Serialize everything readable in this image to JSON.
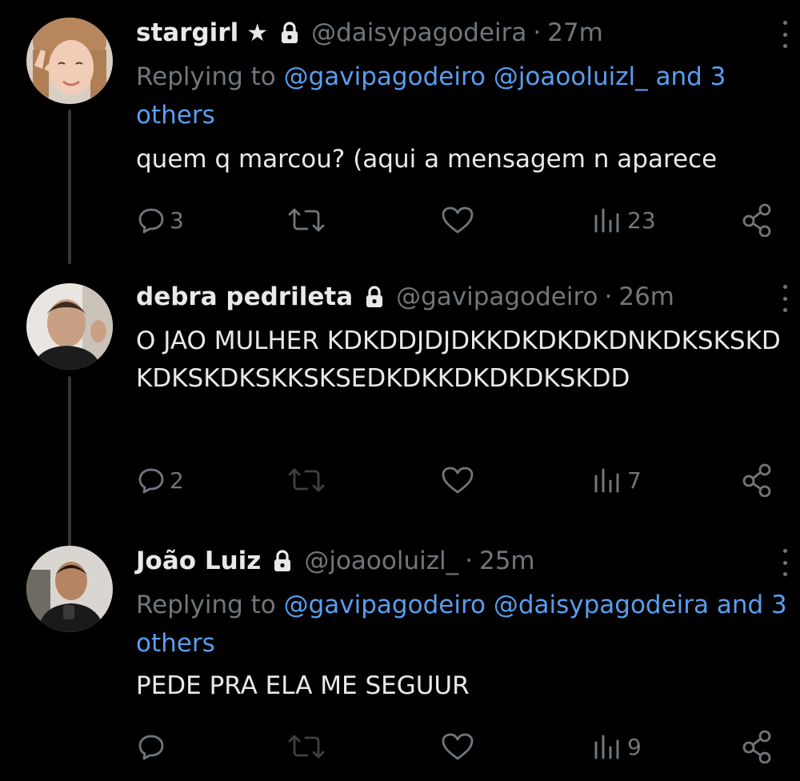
{
  "tweets": [
    {
      "name": "stargirl",
      "badge": "★",
      "handle": "@daisypagodeira",
      "separator": "·",
      "time": "27m",
      "replying_prefix": "Replying to ",
      "replying_mentions": "@gavipagodeiro @joaooluizl_ and 3 others",
      "text": "quem q marcou? (aqui a mensagem n aparece",
      "replies": "3",
      "retweets": "",
      "likes": "",
      "views": "23"
    },
    {
      "name": "debra pedrileta",
      "handle": "@gavipagodeiro",
      "separator": "·",
      "time": "26m",
      "text": "O JAO MULHER KDKDDJDJDKKDKDKDKDNKDKSKSKDKDKSKDKSKKSKSEDKDKKDKDKDKSKDD",
      "replies": "2",
      "retweets": "",
      "likes": "",
      "views": "7"
    },
    {
      "name": "João Luiz",
      "handle": "@joaooluizl_",
      "separator": "·",
      "time": "25m",
      "replying_prefix": "Replying to ",
      "replying_mentions": "@gavipagodeiro @daisypagodeira and 3 others",
      "text": "PEDE PRA ELA ME SEGUUR",
      "replies": "",
      "retweets": "",
      "likes": "",
      "views": "9"
    }
  ],
  "icons": {
    "reply": "reply-icon",
    "retweet": "retweet-icon",
    "like": "heart-icon",
    "views": "views-icon",
    "share": "share-icon",
    "lock": "lock-icon",
    "more": "more-icon"
  },
  "colors": {
    "background": "#000000",
    "text": "#e7e9ea",
    "muted": "#71767b",
    "link": "#5a9eef",
    "thread_line": "#333639"
  }
}
